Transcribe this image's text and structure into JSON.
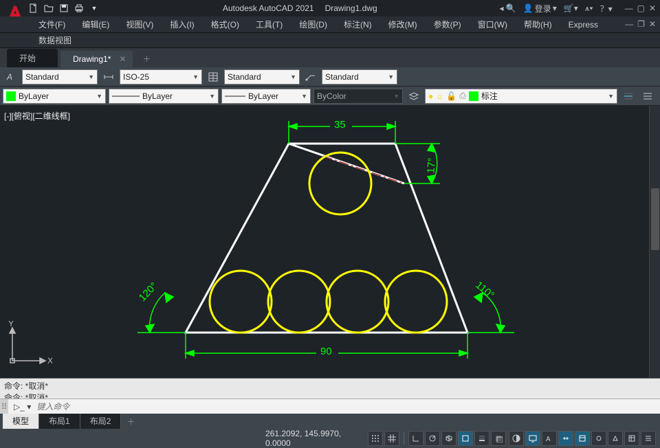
{
  "app": {
    "name": "Autodesk AutoCAD 2021",
    "file": "Drawing1.dwg"
  },
  "titleRight": {
    "login": "登录"
  },
  "menu": [
    "文件(F)",
    "编辑(E)",
    "视图(V)",
    "插入(I)",
    "格式(O)",
    "工具(T)",
    "绘图(D)",
    "标注(N)",
    "修改(M)",
    "参数(P)",
    "窗口(W)",
    "帮助(H)",
    "Express"
  ],
  "menu2": [
    "数据视图"
  ],
  "tabs": [
    {
      "label": "开始",
      "active": false
    },
    {
      "label": "Drawing1*",
      "active": true
    }
  ],
  "prop": {
    "textStyle": "Standard",
    "dimStyle": "ISO-25",
    "tableStyle": "Standard",
    "mlStyle": "Standard"
  },
  "prop2": {
    "color": "ByLayer",
    "linetype": "ByLayer",
    "lineweight": "ByLayer",
    "plotstyle": "ByColor",
    "layerName": "标注"
  },
  "viewport": {
    "label": "[-][俯视][二维线框]"
  },
  "ucs": {
    "x": "X",
    "y": "Y"
  },
  "drawing": {
    "dims": {
      "top": "35",
      "bottom": "90",
      "leftAngle": "120°",
      "rightAngle": "110°",
      "diagAngle": "17°"
    }
  },
  "cmd": {
    "hist": [
      "命令:  *取消*",
      "命令:  *取消*"
    ],
    "placeholder": "键入命令"
  },
  "layouts": [
    "模型",
    "布局1",
    "布局2"
  ],
  "status": {
    "coords": "261.2092, 145.9970, 0.0000"
  },
  "colors": {
    "green": "#00ff00",
    "yellow": "#ffff00",
    "red": "#b13030"
  }
}
